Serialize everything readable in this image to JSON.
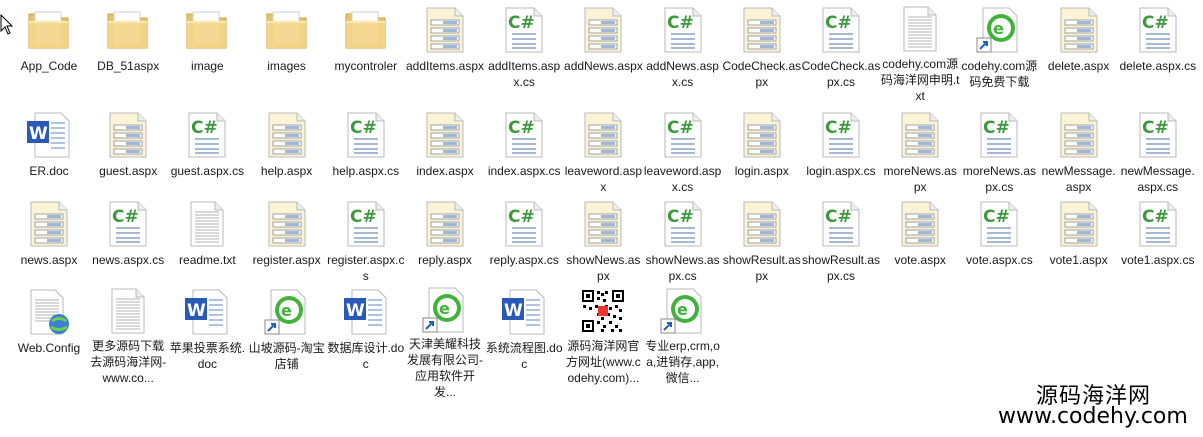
{
  "items": [
    {
      "label": "App_Code",
      "icon": "folder-icon"
    },
    {
      "label": "DB_51aspx",
      "icon": "folder-icon"
    },
    {
      "label": "image",
      "icon": "folder-icon"
    },
    {
      "label": "images",
      "icon": "folder-icon"
    },
    {
      "label": "mycontroler",
      "icon": "folder-icon"
    },
    {
      "label": "addItems.aspx",
      "icon": "aspx-icon"
    },
    {
      "label": "addItems.aspx.cs",
      "icon": "csharp-icon"
    },
    {
      "label": "addNews.aspx",
      "icon": "aspx-icon"
    },
    {
      "label": "addNews.aspx.cs",
      "icon": "csharp-icon"
    },
    {
      "label": "CodeCheck.aspx",
      "icon": "aspx-icon"
    },
    {
      "label": "CodeCheck.aspx.cs",
      "icon": "csharp-icon"
    },
    {
      "label": "codehy.com源码海洋网申明.txt",
      "icon": "text-icon"
    },
    {
      "label": "codehy.com源码免费下载",
      "icon": "shortcut-icon"
    },
    {
      "label": "delete.aspx",
      "icon": "aspx-icon"
    },
    {
      "label": "delete.aspx.cs",
      "icon": "csharp-icon"
    },
    {
      "label": "ER.doc",
      "icon": "word-icon"
    },
    {
      "label": "guest.aspx",
      "icon": "aspx-icon"
    },
    {
      "label": "guest.aspx.cs",
      "icon": "csharp-icon"
    },
    {
      "label": "help.aspx",
      "icon": "aspx-icon"
    },
    {
      "label": "help.aspx.cs",
      "icon": "csharp-icon"
    },
    {
      "label": "index.aspx",
      "icon": "aspx-icon"
    },
    {
      "label": "index.aspx.cs",
      "icon": "csharp-icon"
    },
    {
      "label": "leaveword.aspx",
      "icon": "aspx-icon"
    },
    {
      "label": "leaveword.aspx.cs",
      "icon": "csharp-icon"
    },
    {
      "label": "login.aspx",
      "icon": "aspx-icon"
    },
    {
      "label": "login.aspx.cs",
      "icon": "csharp-icon"
    },
    {
      "label": "moreNews.aspx",
      "icon": "aspx-icon"
    },
    {
      "label": "moreNews.aspx.cs",
      "icon": "csharp-icon"
    },
    {
      "label": "newMessage.aspx",
      "icon": "aspx-icon"
    },
    {
      "label": "newMessage.aspx.cs",
      "icon": "csharp-icon"
    },
    {
      "label": "news.aspx",
      "icon": "aspx-icon"
    },
    {
      "label": "news.aspx.cs",
      "icon": "csharp-icon"
    },
    {
      "label": "readme.txt",
      "icon": "text-icon"
    },
    {
      "label": "register.aspx",
      "icon": "aspx-icon"
    },
    {
      "label": "register.aspx.cs",
      "icon": "csharp-icon"
    },
    {
      "label": "reply.aspx",
      "icon": "aspx-icon"
    },
    {
      "label": "reply.aspx.cs",
      "icon": "csharp-icon"
    },
    {
      "label": "showNews.aspx",
      "icon": "aspx-icon"
    },
    {
      "label": "showNews.aspx.cs",
      "icon": "csharp-icon"
    },
    {
      "label": "showResult.aspx",
      "icon": "aspx-icon"
    },
    {
      "label": "showResult.aspx.cs",
      "icon": "csharp-icon"
    },
    {
      "label": "vote.aspx",
      "icon": "aspx-icon"
    },
    {
      "label": "vote.aspx.cs",
      "icon": "csharp-icon"
    },
    {
      "label": "vote1.aspx",
      "icon": "aspx-icon"
    },
    {
      "label": "vote1.aspx.cs",
      "icon": "csharp-icon"
    },
    {
      "label": "Web.Config",
      "icon": "config-icon"
    },
    {
      "label": "更多源码下载去源码海洋网-www.co...",
      "icon": "text-icon"
    },
    {
      "label": "苹果投票系统.doc",
      "icon": "word-icon"
    },
    {
      "label": "山坡源码-淘宝店铺",
      "icon": "shortcut-icon"
    },
    {
      "label": "数据库设计.doc",
      "icon": "word-icon"
    },
    {
      "label": "天津美耀科技发展有限公司-应用软件开发...",
      "icon": "shortcut-icon"
    },
    {
      "label": "系统流程图.doc",
      "icon": "word-icon"
    },
    {
      "label": "源码海洋网官方网址(www.codehy.com)...",
      "icon": "qrcode-icon"
    },
    {
      "label": "专业erp,crm,oa,进销存,app,微信...",
      "icon": "shortcut-icon"
    }
  ],
  "watermark": {
    "site_name": "源码海洋网",
    "url": "www.codehy.com"
  },
  "colors": {
    "folder": "#f3d58a",
    "csharp": "#3c9a3c",
    "word": "#2a5ab8",
    "shortcut": "#41b23a"
  }
}
